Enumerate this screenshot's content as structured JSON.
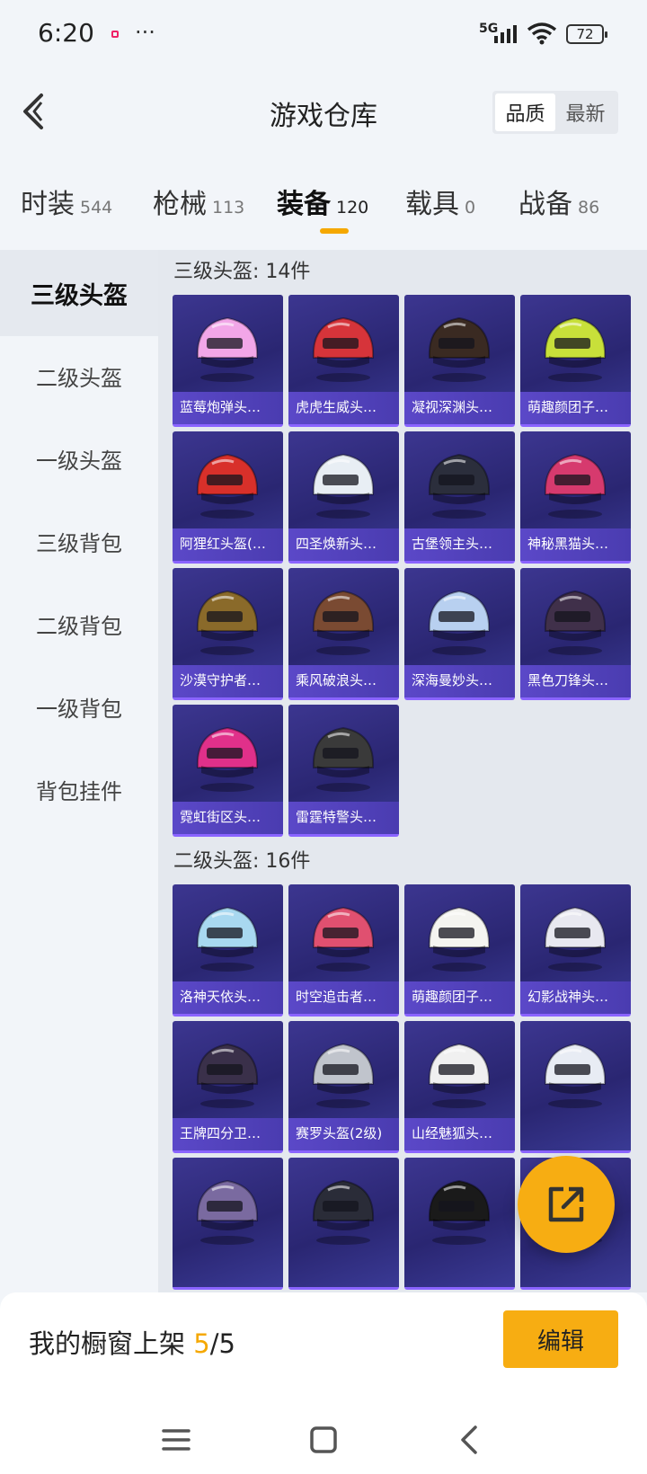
{
  "status": {
    "time": "6:20",
    "more": "···",
    "network": "5G",
    "battery": "72"
  },
  "header": {
    "title": "游戏仓库",
    "sort": [
      "品质",
      "最新"
    ]
  },
  "categories": [
    {
      "label": "时装",
      "count": "544"
    },
    {
      "label": "枪械",
      "count": "113"
    },
    {
      "label": "装备",
      "count": "120"
    },
    {
      "label": "载具",
      "count": "0"
    },
    {
      "label": "战备",
      "count": "86"
    }
  ],
  "sidebar": [
    "三级头盔",
    "二级头盔",
    "一级头盔",
    "三级背包",
    "二级背包",
    "一级背包",
    "背包挂件"
  ],
  "sections": [
    {
      "title": "三级头盔: 14件",
      "items": [
        "蓝莓炮弹头…",
        "虎虎生威头…",
        "凝视深渊头…",
        "萌趣颜团子…",
        "阿狸红头盔(…",
        "四圣焕新头…",
        "古堡领主头…",
        "神秘黑猫头…",
        "沙漠守护者…",
        "乘风破浪头…",
        "深海曼妙头…",
        "黑色刀锋头…",
        "霓虹街区头…",
        "雷霆特警头…"
      ]
    },
    {
      "title": "二级头盔: 16件",
      "items": [
        "洛神天依头…",
        "时空追击者…",
        "萌趣颜团子…",
        "幻影战神头…",
        "王牌四分卫…",
        "赛罗头盔(2级)",
        "山经魅狐头…",
        "",
        "",
        "",
        "",
        ""
      ]
    }
  ],
  "helmet_colors": [
    "#f2a6e8",
    "#d6343a",
    "#3a2a22",
    "#c8e03a",
    "#d8302a",
    "#e8eef4",
    "#2b2e3c",
    "#d63a6e",
    "#8a6a2a",
    "#7a4a32",
    "#b8d0f0",
    "#40304a",
    "#e0308a",
    "#3a3a3a",
    "#a8d8f0",
    "#e05070",
    "#f4f4f0",
    "#e8e8f0",
    "#3a304a",
    "#c0c4cc",
    "#f0f0f0",
    "#e8ecf4",
    "#7a6aa0",
    "#2a2c38",
    "#1a1a1a",
    "#d63a6e"
  ],
  "bottom": {
    "showcase_label": "我的橱窗上架",
    "showcase_current": "5",
    "showcase_total": "/5",
    "edit": "编辑"
  }
}
